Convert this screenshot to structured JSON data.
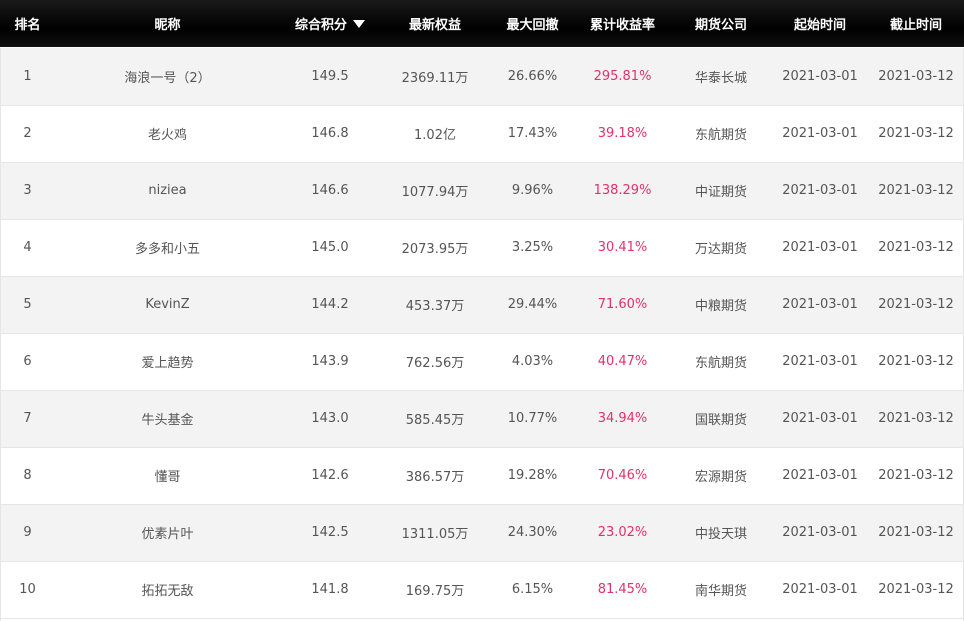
{
  "header": {
    "rank": "排名",
    "nickname": "昵称",
    "score": "综合积分",
    "equity": "最新权益",
    "max_drawdown": "最大回撤",
    "cum_return": "累计收益率",
    "broker": "期货公司",
    "start": "起始时间",
    "end": "截止时间"
  },
  "sort_icon": "triangle-down-icon",
  "colors": {
    "header_bg": "#000000",
    "header_text": "#ffffff",
    "return_text": "#e0336b",
    "row_alt_bg": "#f3f3f3"
  },
  "rows": [
    {
      "rank": "1",
      "nickname": "海浪一号（2）",
      "score": "149.5",
      "equity": "2369.11万",
      "max_drawdown": "26.66%",
      "cum_return": "295.81%",
      "broker": "华泰长城",
      "start": "2021-03-01",
      "end": "2021-03-12"
    },
    {
      "rank": "2",
      "nickname": "老火鸡",
      "score": "146.8",
      "equity": "1.02亿",
      "max_drawdown": "17.43%",
      "cum_return": "39.18%",
      "broker": "东航期货",
      "start": "2021-03-01",
      "end": "2021-03-12"
    },
    {
      "rank": "3",
      "nickname": "niziea",
      "score": "146.6",
      "equity": "1077.94万",
      "max_drawdown": "9.96%",
      "cum_return": "138.29%",
      "broker": "中证期货",
      "start": "2021-03-01",
      "end": "2021-03-12"
    },
    {
      "rank": "4",
      "nickname": "多多和小五",
      "score": "145.0",
      "equity": "2073.95万",
      "max_drawdown": "3.25%",
      "cum_return": "30.41%",
      "broker": "万达期货",
      "start": "2021-03-01",
      "end": "2021-03-12"
    },
    {
      "rank": "5",
      "nickname": "KevinZ",
      "score": "144.2",
      "equity": "453.37万",
      "max_drawdown": "29.44%",
      "cum_return": "71.60%",
      "broker": "中粮期货",
      "start": "2021-03-01",
      "end": "2021-03-12"
    },
    {
      "rank": "6",
      "nickname": "爱上趋势",
      "score": "143.9",
      "equity": "762.56万",
      "max_drawdown": "4.03%",
      "cum_return": "40.47%",
      "broker": "东航期货",
      "start": "2021-03-01",
      "end": "2021-03-12"
    },
    {
      "rank": "7",
      "nickname": "牛头基金",
      "score": "143.0",
      "equity": "585.45万",
      "max_drawdown": "10.77%",
      "cum_return": "34.94%",
      "broker": "国联期货",
      "start": "2021-03-01",
      "end": "2021-03-12"
    },
    {
      "rank": "8",
      "nickname": "懂哥",
      "score": "142.6",
      "equity": "386.57万",
      "max_drawdown": "19.28%",
      "cum_return": "70.46%",
      "broker": "宏源期货",
      "start": "2021-03-01",
      "end": "2021-03-12"
    },
    {
      "rank": "9",
      "nickname": "优素片叶",
      "score": "142.5",
      "equity": "1311.05万",
      "max_drawdown": "24.30%",
      "cum_return": "23.02%",
      "broker": "中投天琪",
      "start": "2021-03-01",
      "end": "2021-03-12"
    },
    {
      "rank": "10",
      "nickname": "拓拓无敌",
      "score": "141.8",
      "equity": "169.75万",
      "max_drawdown": "6.15%",
      "cum_return": "81.45%",
      "broker": "南华期货",
      "start": "2021-03-01",
      "end": "2021-03-12"
    }
  ]
}
